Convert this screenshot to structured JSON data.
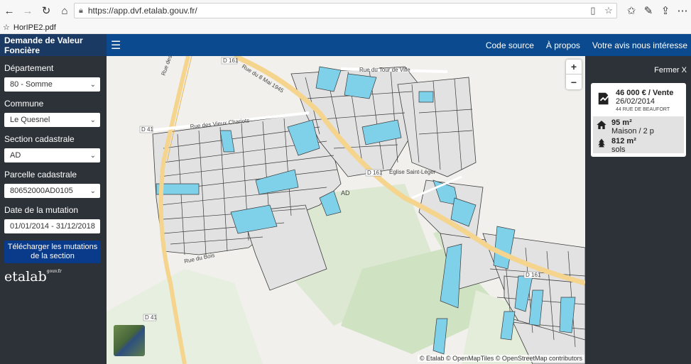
{
  "browser": {
    "url": "https://app.dvf.etalab.gouv.fr/",
    "bookmark": "HorIPE2.pdf"
  },
  "header": {
    "brand": "Demande de Valeur Foncière",
    "nav": [
      "Code source",
      "À propos",
      "Votre avis nous intéresse"
    ]
  },
  "sidebar": {
    "departement_label": "Département",
    "departement_value": "80 - Somme",
    "commune_label": "Commune",
    "commune_value": "Le Quesnel",
    "section_label": "Section cadastrale",
    "section_value": "AD",
    "parcelle_label": "Parcelle cadastrale",
    "parcelle_value": "80652000AD0105",
    "date_label": "Date de la mutation",
    "date_value": "01/01/2014 - 31/12/2018",
    "download_label": "Télécharger les mutations de la section",
    "logo": "etalab",
    "logo_sup": "gouv.fr"
  },
  "map": {
    "road_labels": [
      "D 161",
      "Rue du 8 Mai 1945",
      "Rue des Vieux Chariots",
      "Rue des Buttes",
      "D 41",
      "Rue du Tour de Ville",
      "D 161",
      "Eglise Saint-Léger",
      "AD",
      "D 161",
      "D 41",
      "Rue du Bois"
    ],
    "attribution": "© Etalab © OpenMapTiles © OpenStreetMap contributors",
    "zoom_in": "+",
    "zoom_out": "−"
  },
  "panel": {
    "close": "Fermer X",
    "price": "46 000 € / Vente",
    "date": "26/02/2014",
    "address": "44 RUE DE BEAUFORT",
    "surface": "95 m²",
    "type": "Maison / 2 p",
    "land": "812 m²",
    "land_type": "sols"
  }
}
